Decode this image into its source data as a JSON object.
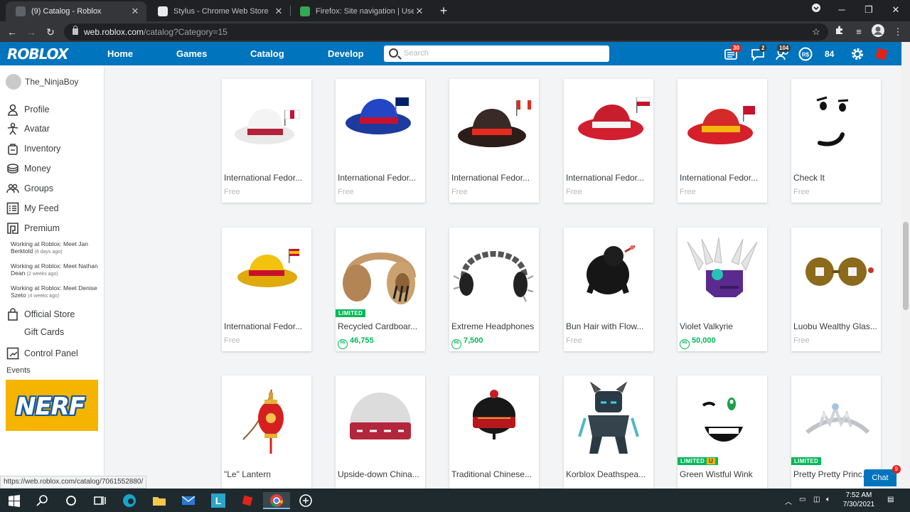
{
  "browser": {
    "tabs": [
      {
        "title": "(9) Catalog - Roblox",
        "active": true
      },
      {
        "title": "Stylus - Chrome Web Store",
        "active": false
      },
      {
        "title": "Firefox: Site navigation | Userstyle",
        "active": false
      }
    ],
    "url_host": "web.roblox.com",
    "url_path": "/catalog?Category=15",
    "status_url": "https://web.roblox.com/catalog/7061552880/"
  },
  "header": {
    "logo": "ROBLOX",
    "nav": [
      "Home",
      "Games",
      "Catalog",
      "Develop"
    ],
    "search_placeholder": "Search",
    "notifications_badge": "30",
    "messages_badge": "2",
    "friends_badge": "104",
    "robux": "84"
  },
  "sidebar": {
    "username": "The_NinjaBoy",
    "items": [
      "Profile",
      "Avatar",
      "Inventory",
      "Money",
      "Groups",
      "My Feed",
      "Premium"
    ],
    "blog": [
      {
        "title": "Working at Roblox: Meet Jan Berktold",
        "ago": "(6 days ago)"
      },
      {
        "title": "Working at Roblox: Meet Nathan Dean",
        "ago": "(2 weeks ago)"
      },
      {
        "title": "Working at Roblox: Meet Denise Szeto",
        "ago": "(4 weeks ago)"
      }
    ],
    "official_store": "Official Store",
    "gift_cards": "Gift Cards",
    "control_panel": "Control Panel",
    "events": "Events",
    "ad_text": "NERF"
  },
  "catalog": [
    {
      "name": "International Fedor...",
      "price": "Free",
      "paid": false,
      "limited": ""
    },
    {
      "name": "International Fedor...",
      "price": "Free",
      "paid": false,
      "limited": ""
    },
    {
      "name": "International Fedor...",
      "price": "Free",
      "paid": false,
      "limited": ""
    },
    {
      "name": "International Fedor...",
      "price": "Free",
      "paid": false,
      "limited": ""
    },
    {
      "name": "International Fedor...",
      "price": "Free",
      "paid": false,
      "limited": ""
    },
    {
      "name": "Check It",
      "price": "Free",
      "paid": false,
      "limited": ""
    },
    {
      "name": "International Fedor...",
      "price": "Free",
      "paid": false,
      "limited": ""
    },
    {
      "name": "Recycled Cardboar...",
      "price": "46,755",
      "paid": true,
      "limited": "LIMITED"
    },
    {
      "name": "Extreme Headphones",
      "price": "7,500",
      "paid": true,
      "limited": ""
    },
    {
      "name": "Bun Hair with Flow...",
      "price": "Free",
      "paid": false,
      "limited": ""
    },
    {
      "name": "Violet Valkyrie",
      "price": "50,000",
      "paid": true,
      "limited": ""
    },
    {
      "name": "Luobu Wealthy Glas...",
      "price": "Free",
      "paid": false,
      "limited": ""
    },
    {
      "name": "\"Le\" Lantern",
      "price": "",
      "paid": false,
      "limited": ""
    },
    {
      "name": "Upside-down China...",
      "price": "",
      "paid": false,
      "limited": ""
    },
    {
      "name": "Traditional Chinese...",
      "price": "",
      "paid": false,
      "limited": ""
    },
    {
      "name": "Korblox Deathspea...",
      "price": "",
      "paid": false,
      "limited": ""
    },
    {
      "name": "Green Wistful Wink",
      "price": "",
      "paid": false,
      "limited": "LIMITED",
      "unique": "U"
    },
    {
      "name": "Pretty Pretty Princ...",
      "price": "",
      "paid": false,
      "limited": "LIMITED"
    }
  ],
  "chat": {
    "label": "Chat",
    "badge": "9"
  },
  "taskbar": {
    "time": "7:52 AM",
    "date": "7/30/2021"
  }
}
